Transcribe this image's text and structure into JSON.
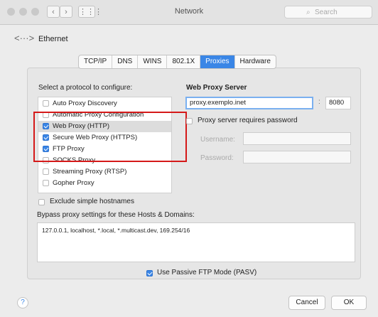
{
  "window": {
    "title": "Network",
    "search_placeholder": "Search"
  },
  "header": {
    "interface": "Ethernet"
  },
  "tabs": [
    {
      "label": "TCP/IP",
      "active": false
    },
    {
      "label": "DNS",
      "active": false
    },
    {
      "label": "WINS",
      "active": false
    },
    {
      "label": "802.1X",
      "active": false
    },
    {
      "label": "Proxies",
      "active": true
    },
    {
      "label": "Hardware",
      "active": false
    }
  ],
  "protocols": {
    "heading": "Select a protocol to configure:",
    "items": [
      {
        "label": "Auto Proxy Discovery",
        "checked": false
      },
      {
        "label": "Automatic Proxy Configuration",
        "checked": false
      },
      {
        "label": "Web Proxy (HTTP)",
        "checked": true
      },
      {
        "label": "Secure Web Proxy (HTTPS)",
        "checked": true
      },
      {
        "label": "FTP Proxy",
        "checked": true
      },
      {
        "label": "SOCKS Proxy",
        "checked": false
      },
      {
        "label": "Streaming Proxy (RTSP)",
        "checked": false
      },
      {
        "label": "Gopher Proxy",
        "checked": false
      }
    ]
  },
  "proxy_server": {
    "heading": "Web Proxy Server",
    "server": "proxy.exemplo.inet",
    "port": "8080",
    "requires_password_label": "Proxy server requires password",
    "username_label": "Username:",
    "password_label": "Password:"
  },
  "exclude_simple": {
    "label": "Exclude simple hostnames",
    "checked": false
  },
  "bypass": {
    "label": "Bypass proxy settings for these Hosts & Domains:",
    "value": "127.0.0.1, localhost, *.local, *.multicast.dev, 169.254/16"
  },
  "passive_ftp": {
    "label": "Use Passive FTP Mode (PASV)",
    "checked": true
  },
  "buttons": {
    "help": "?",
    "cancel": "Cancel",
    "ok": "OK"
  },
  "colors": {
    "accent": "#3a86e6",
    "highlight_box": "#d51919"
  }
}
